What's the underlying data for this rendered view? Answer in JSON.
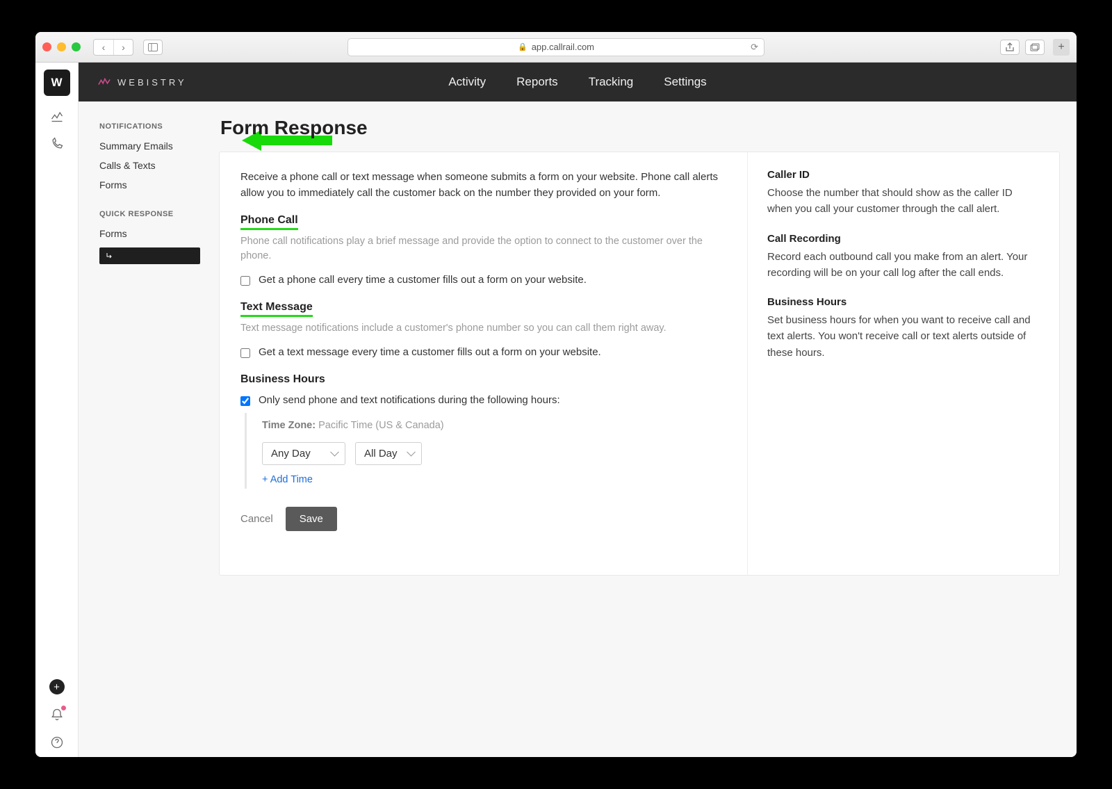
{
  "browser": {
    "url": "app.callrail.com"
  },
  "brand": {
    "letter": "W",
    "name": "WEBISTRY"
  },
  "topnav": {
    "activity": "Activity",
    "reports": "Reports",
    "tracking": "Tracking",
    "settings": "Settings"
  },
  "sidebar": {
    "section1": "NOTIFICATIONS",
    "links1": {
      "summary": "Summary Emails",
      "calls": "Calls & Texts",
      "forms": "Forms"
    },
    "section2": "QUICK RESPONSE",
    "links2": {
      "forms": "Forms"
    }
  },
  "page": {
    "title": "Form Response",
    "intro": "Receive a phone call or text message when someone submits a form on your website. Phone call alerts allow you to immediately call the customer back on the number they provided on your form.",
    "phone": {
      "title": "Phone Call",
      "desc": "Phone call notifications play a brief message and provide the option to connect to the customer over the phone.",
      "checkbox": "Get a phone call every time a customer fills out a form on your website."
    },
    "text": {
      "title": "Text Message",
      "desc": "Text message notifications include a customer's phone number so you can call them right away.",
      "checkbox": "Get a text message every time a customer fills out a form on your website."
    },
    "bh": {
      "title": "Business Hours",
      "checkbox": "Only send phone and text notifications during the following hours:",
      "tz_label": "Time Zone:",
      "tz_value": "Pacific Time (US & Canada)",
      "day": "Any Day",
      "time": "All Day",
      "add": "+ Add Time"
    },
    "actions": {
      "cancel": "Cancel",
      "save": "Save"
    }
  },
  "aside": {
    "caller": {
      "h": "Caller ID",
      "p": "Choose the number that should show as the caller ID when you call your customer through the call alert."
    },
    "rec": {
      "h": "Call Recording",
      "p": "Record each outbound call you make from an alert. Your recording will be on your call log after the call ends."
    },
    "hours": {
      "h": "Business Hours",
      "p": "Set business hours for when you want to receive call and text alerts. You won't receive call or text alerts outside of these hours."
    }
  }
}
